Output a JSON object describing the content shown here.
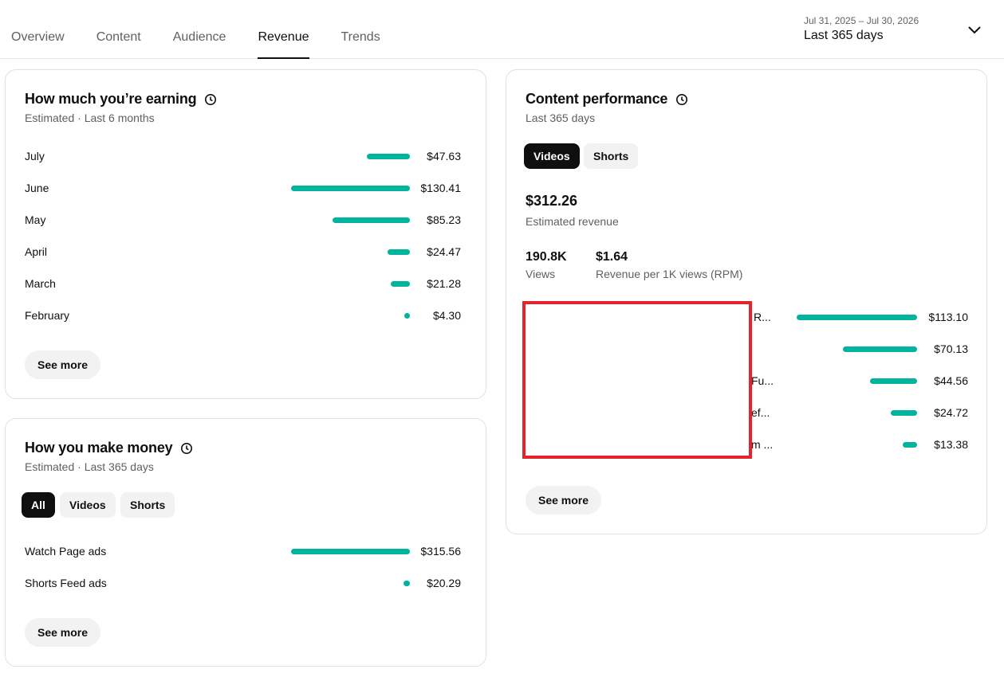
{
  "tabs": [
    {
      "label": "Overview",
      "active": false
    },
    {
      "label": "Content",
      "active": false
    },
    {
      "label": "Audience",
      "active": false
    },
    {
      "label": "Revenue",
      "active": true
    },
    {
      "label": "Trends",
      "active": false
    }
  ],
  "date_range": {
    "range": "Jul 31, 2025 – Jul 30, 2026",
    "label": "Last 365 days",
    "icon": "chevron-down-icon"
  },
  "earning": {
    "title": "How much you’re earning",
    "subtitle": "Estimated · Last 6 months",
    "rows": [
      {
        "label": "July",
        "value": "$47.63"
      },
      {
        "label": "June",
        "value": "$130.41"
      },
      {
        "label": "May",
        "value": "$85.23"
      },
      {
        "label": "April",
        "value": "$24.47"
      },
      {
        "label": "March",
        "value": "$21.28"
      },
      {
        "label": "February",
        "value": "$4.30"
      }
    ],
    "see_more": "See more"
  },
  "make_money": {
    "title": "How you make money",
    "subtitle": "Estimated · Last 365 days",
    "chips": [
      {
        "label": "All",
        "selected": true
      },
      {
        "label": "Videos",
        "selected": false
      },
      {
        "label": "Shorts",
        "selected": false
      }
    ],
    "rows": [
      {
        "label": "Watch Page ads",
        "value": "$315.56"
      },
      {
        "label": "Shorts Feed ads",
        "value": "$20.29"
      }
    ],
    "see_more": "See more"
  },
  "content_perf": {
    "title": "Content performance",
    "subtitle": "Last 365 days",
    "chips": [
      {
        "label": "Videos",
        "selected": true
      },
      {
        "label": "Shorts",
        "selected": false
      }
    ],
    "total": "$312.26",
    "total_label": "Estimated revenue",
    "views": "190.8K",
    "views_label": "Views",
    "rpm": "$1.64",
    "rpm_label": "Revenue per 1K views (RPM)",
    "rows": [
      {
        "label": "R...",
        "value": "$113.10"
      },
      {
        "label": "",
        "value": "$70.13"
      },
      {
        "label": "Fu...",
        "value": "$44.56"
      },
      {
        "label": "ef...",
        "value": "$24.72"
      },
      {
        "label": "m ...",
        "value": "$13.38"
      }
    ],
    "see_more": "See more"
  },
  "colors": {
    "bar": "#00b39c",
    "redaction": "#e3242b",
    "accent": "#0f0f0f"
  }
}
